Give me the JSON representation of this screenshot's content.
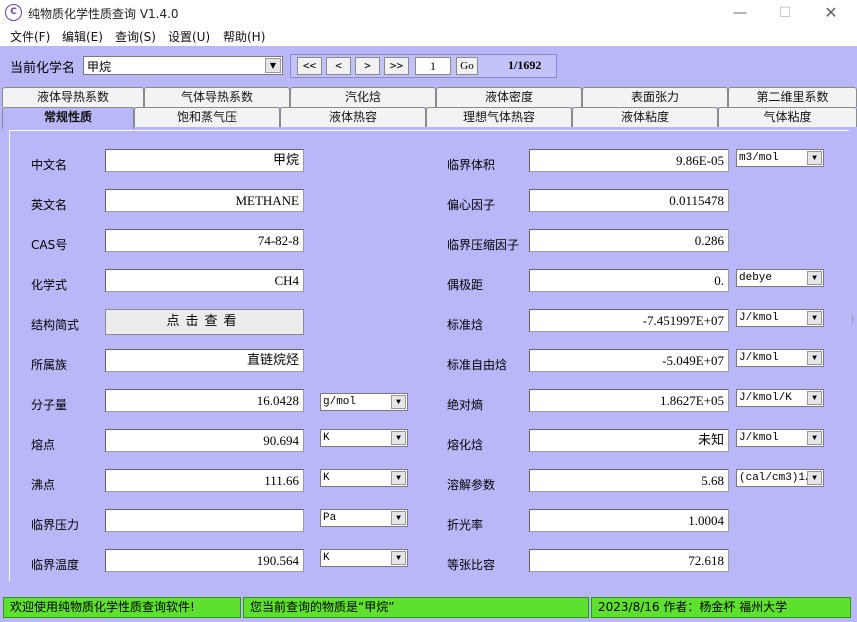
{
  "window": {
    "title": "纯物质化学性质查询 V1.4.0",
    "icon_text": "C",
    "minimize_icon": "—",
    "maximize_icon": "☐",
    "close_icon": "✕"
  },
  "menu": [
    "文件(F)",
    "编辑(E)",
    "查询(S)",
    "设置(U)",
    "帮助(H)"
  ],
  "toolbar": {
    "compound_label": "当前化学名",
    "compound_value": "甲烷",
    "nav": {
      "first": "<<",
      "prev": "<",
      "next": ">",
      "last": ">>"
    },
    "page_value": "1",
    "go_label": "Go",
    "page_count": "1/1692"
  },
  "tabs_row1": [
    "液体导热系数",
    "气体导热系数",
    "汽化焓",
    "液体密度",
    "表面张力",
    "第二维里系数"
  ],
  "tabs_row2": [
    "常规性质",
    "饱和蒸气压",
    "液体热容",
    "理想气体热容",
    "液体粘度",
    "气体粘度"
  ],
  "active_tab": "常规性质",
  "left_props": [
    {
      "label": "中文名",
      "value": "甲烷",
      "unit": null
    },
    {
      "label": "英文名",
      "value": "METHANE",
      "unit": null
    },
    {
      "label": "CAS号",
      "value": "74-82-8",
      "unit": null
    },
    {
      "label": "化学式",
      "value": "CH4",
      "unit": null
    },
    {
      "label": "结构简式",
      "button": "点击查看"
    },
    {
      "label": "所属族",
      "value": "直链烷烃",
      "unit": null
    },
    {
      "label": "分子量",
      "value": "16.0428",
      "unit": "g/mol"
    },
    {
      "label": "熔点",
      "value": "90.694",
      "unit": "K"
    },
    {
      "label": "沸点",
      "value": "111.66",
      "unit": "K"
    },
    {
      "label": "临界压力",
      "value": "",
      "unit": "Pa"
    },
    {
      "label": "临界温度",
      "value": "190.564",
      "unit": "K"
    }
  ],
  "right_props": [
    {
      "label": "临界体积",
      "value": "9.86E-05",
      "unit": "m3/mol"
    },
    {
      "label": "偏心因子",
      "value": "0.0115478",
      "unit": null
    },
    {
      "label": "临界压缩因子",
      "value": "0.286",
      "unit": null
    },
    {
      "label": "偶极距",
      "value": "0.",
      "unit": "debye"
    },
    {
      "label": "标准焓",
      "value": "-7.451997E+07",
      "unit": "J/kmol"
    },
    {
      "label": "标准自由焓",
      "value": "-5.049E+07",
      "unit": "J/kmol"
    },
    {
      "label": "绝对熵",
      "value": "1.8627E+05",
      "unit": "J/kmol/K"
    },
    {
      "label": "熔化焓",
      "value": "未知",
      "unit": "J/kmol"
    },
    {
      "label": "溶解参数",
      "value": "5.68",
      "unit": "(cal/cm3)1/"
    },
    {
      "label": "折光率",
      "value": "1.0004",
      "unit": null
    },
    {
      "label": "等张比容",
      "value": "72.618",
      "unit": null
    }
  ],
  "status": {
    "welcome": "欢迎使用纯物质化学性质查询软件!",
    "current": "您当前查询的物质是“甲烷”",
    "info": "2023/8/16    作者：杨金杯   福州大学"
  },
  "colors": {
    "background": "#b9b7f7",
    "status_green": "#5ee02e"
  }
}
